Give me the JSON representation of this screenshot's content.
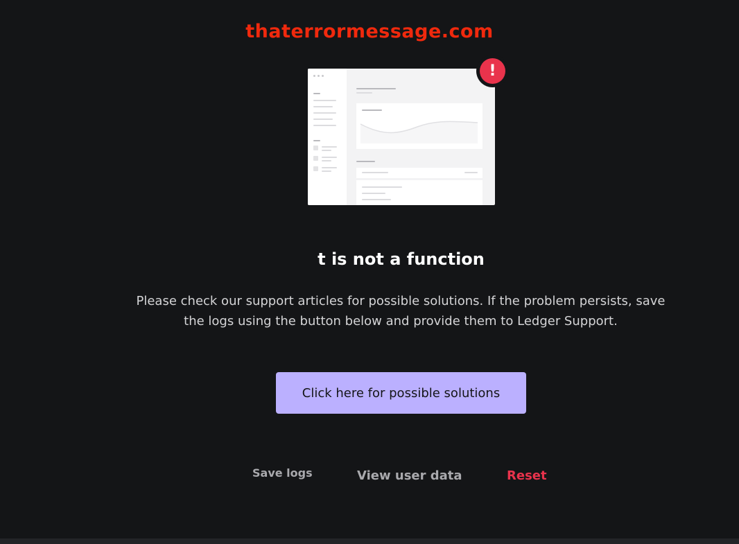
{
  "watermark": "thaterrormessage.com",
  "illustration": {
    "icon": "app-window-illustration",
    "badge_icon": "exclamation-icon",
    "badge_text": "!"
  },
  "error": {
    "title": "t is not a function",
    "description": "Please check our support articles for possible solutions. If the problem persists, save the logs using the button below and provide them to Ledger Support."
  },
  "actions": {
    "solutions_label": "Click here for possible solutions",
    "save_logs_label": "Save logs",
    "view_user_data_label": "View user data",
    "reset_label": "Reset"
  },
  "colors": {
    "background": "#141517",
    "accent": "#bbb0ff",
    "danger": "#e9334c",
    "watermark": "#f0290d"
  }
}
